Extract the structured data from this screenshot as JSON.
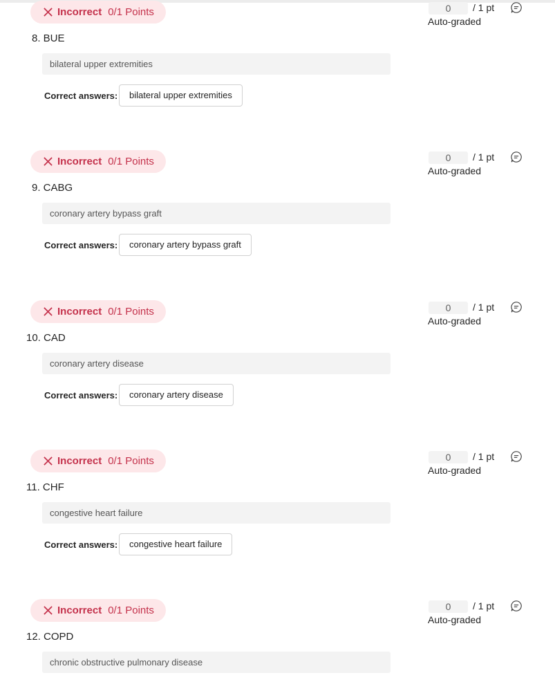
{
  "colors": {
    "incorrect_text": "#c4314b",
    "incorrect_bg": "#fde7e9",
    "input_bg": "#f3f3f3"
  },
  "questions": [
    {
      "status": "Incorrect",
      "points": "0/1 Points",
      "title": "8. BUE",
      "response": "bilateral upper extremities",
      "correct_label": "Correct answers:",
      "correct_answer": "bilateral upper extremities",
      "score": "0",
      "out_of": "/ 1 pt",
      "grading": "Auto-graded",
      "comment_icon": "comment-icon"
    },
    {
      "status": "Incorrect",
      "points": "0/1 Points",
      "title": "9. CABG",
      "response": "coronary artery bypass graft",
      "correct_label": "Correct answers:",
      "correct_answer": "coronary artery bypass graft",
      "score": "0",
      "out_of": "/ 1 pt",
      "grading": "Auto-graded",
      "comment_icon": "comment-icon"
    },
    {
      "status": "Incorrect",
      "points": "0/1 Points",
      "title": "10. CAD",
      "response": "coronary artery disease",
      "correct_label": "Correct answers:",
      "correct_answer": "coronary artery disease",
      "score": "0",
      "out_of": "/ 1 pt",
      "grading": "Auto-graded",
      "comment_icon": "comment-icon"
    },
    {
      "status": "Incorrect",
      "points": "0/1 Points",
      "title": "11. CHF",
      "response": "congestive heart failure",
      "correct_label": "Correct answers:",
      "correct_answer": "congestive heart failure",
      "score": "0",
      "out_of": "/ 1 pt",
      "grading": "Auto-graded",
      "comment_icon": "comment-icon"
    },
    {
      "status": "Incorrect",
      "points": "0/1 Points",
      "title": "12. COPD",
      "response": "chronic obstructive pulmonary disease",
      "correct_label": "",
      "correct_answer": "",
      "score": "0",
      "out_of": "/ 1 pt",
      "grading": "Auto-graded",
      "comment_icon": "comment-icon"
    }
  ]
}
